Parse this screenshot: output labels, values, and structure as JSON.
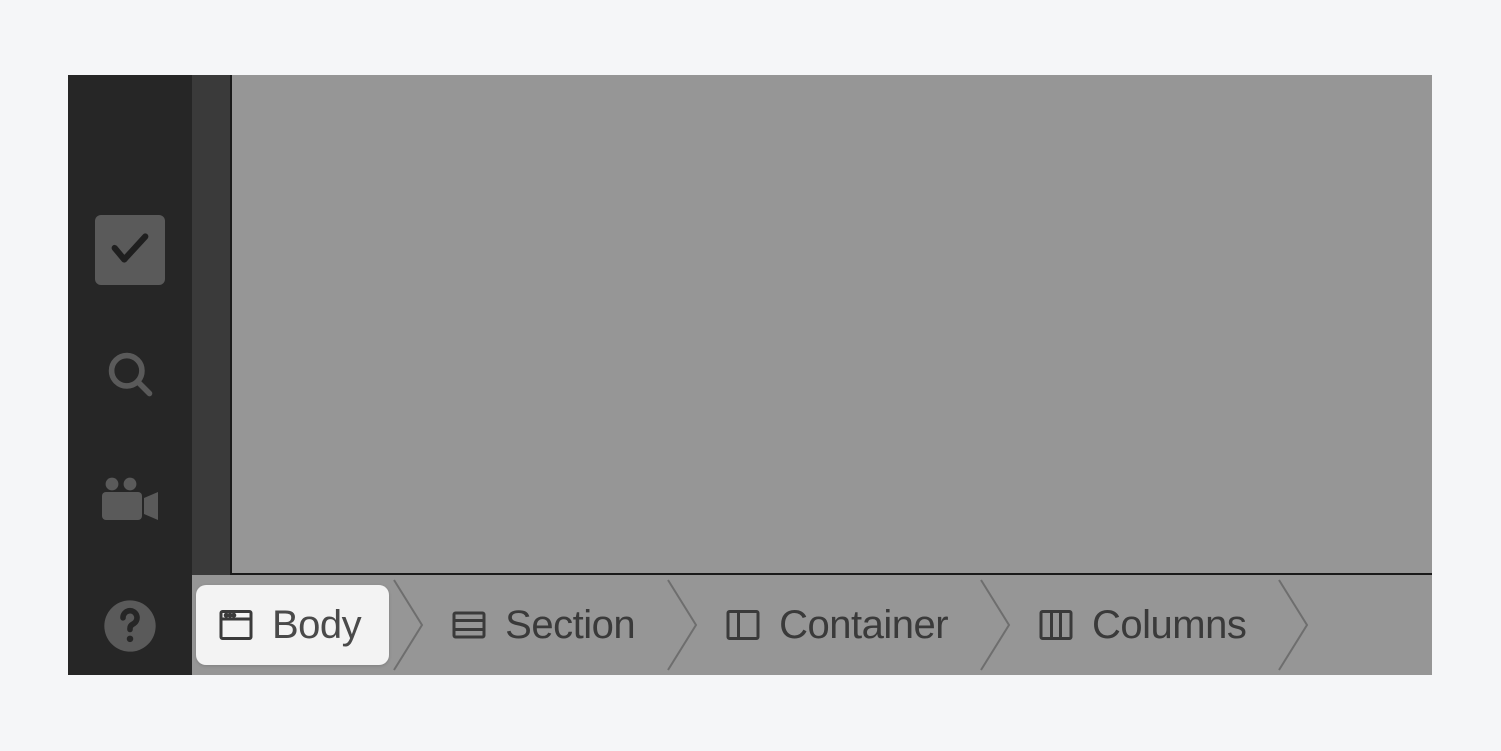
{
  "sidebar": {
    "icons": [
      "check",
      "search",
      "video",
      "help"
    ]
  },
  "breadcrumb": {
    "items": [
      {
        "icon": "body",
        "label": "Body",
        "active": true
      },
      {
        "icon": "section",
        "label": "Section",
        "active": false
      },
      {
        "icon": "container",
        "label": "Container",
        "active": false
      },
      {
        "icon": "columns",
        "label": "Columns",
        "active": false
      }
    ]
  }
}
